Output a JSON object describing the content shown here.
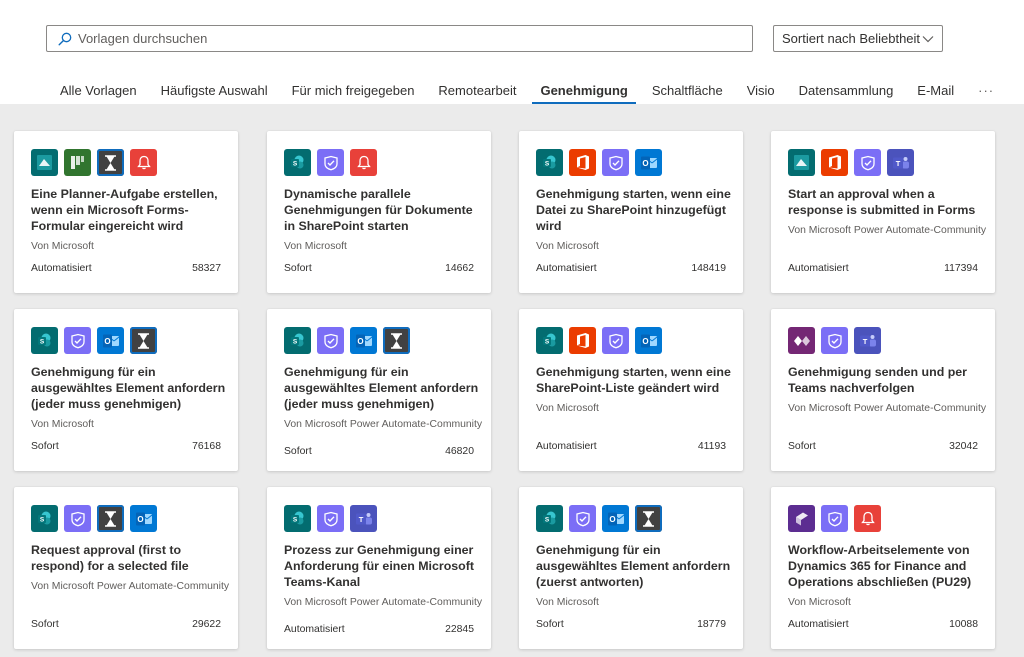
{
  "search": {
    "placeholder": "Vorlagen durchsuchen"
  },
  "sort": {
    "label": "Sortiert nach Beliebtheit"
  },
  "tabs": [
    {
      "label": "Alle Vorlagen",
      "active": false
    },
    {
      "label": "Häufigste Auswahl",
      "active": false
    },
    {
      "label": "Für mich freigegeben",
      "active": false
    },
    {
      "label": "Remotearbeit",
      "active": false
    },
    {
      "label": "Genehmigung",
      "active": true
    },
    {
      "label": "Schaltfläche",
      "active": false
    },
    {
      "label": "Visio",
      "active": false
    },
    {
      "label": "Datensammlung",
      "active": false
    },
    {
      "label": "E-Mail",
      "active": false
    }
  ],
  "more_tabs": "···",
  "colors": {
    "forms": "#036c70",
    "planner": "#31752f",
    "timer": "#414141",
    "notification": "#e8413a",
    "sharepoint": "#036c70",
    "approvals": "#7b6ef6",
    "office": "#eb3c00",
    "outlook": "#0078d4",
    "teams": "#4b53bc",
    "powerapps": "#742774",
    "dynamics": "#5c2d91",
    "accent": "#0f6cbd"
  },
  "cards": [
    {
      "title": "Eine Planner-Aufgabe erstellen, wenn ein Microsoft Forms-Formular eingereicht wird",
      "author": "Von Microsoft",
      "type": "Automatisiert",
      "count": "58327",
      "icons": [
        "forms-icon",
        "planner-icon",
        "timer-icon",
        "notification-icon"
      ]
    },
    {
      "title": "Dynamische parallele Genehmigungen für Dokumente in SharePoint starten",
      "author": "Von Microsoft",
      "type": "Sofort",
      "count": "14662",
      "icons": [
        "sharepoint-icon",
        "approvals-icon",
        "notification-icon"
      ]
    },
    {
      "title": "Genehmigung starten, wenn eine Datei zu SharePoint hinzugefügt wird",
      "author": "Von Microsoft",
      "type": "Automatisiert",
      "count": "148419",
      "icons": [
        "sharepoint-icon",
        "office-icon",
        "approvals-icon",
        "outlook-icon"
      ]
    },
    {
      "title": "Start an approval when a response is submitted in Forms",
      "author": "Von Microsoft Power Automate-Community",
      "type": "Automatisiert",
      "count": "117394",
      "icons": [
        "forms-icon",
        "office-icon",
        "approvals-icon",
        "teams-icon"
      ]
    },
    {
      "title": "Genehmigung für ein ausgewähltes Element anfordern (jeder muss genehmigen)",
      "author": "Von Microsoft",
      "type": "Sofort",
      "count": "76168",
      "icons": [
        "sharepoint-icon",
        "approvals-icon",
        "outlook-icon",
        "timer-icon"
      ]
    },
    {
      "title": "Genehmigung für ein ausgewähltes Element anfordern (jeder muss genehmigen)",
      "author": "Von Microsoft Power Automate-Community",
      "type": "Sofort",
      "count": "46820",
      "icons": [
        "sharepoint-icon",
        "approvals-icon",
        "outlook-icon",
        "timer-icon"
      ]
    },
    {
      "title": "Genehmigung starten, wenn eine SharePoint-Liste geändert wird",
      "author": "Von Microsoft",
      "type": "Automatisiert",
      "count": "41193",
      "icons": [
        "sharepoint-icon",
        "office-icon",
        "approvals-icon",
        "outlook-icon"
      ]
    },
    {
      "title": "Genehmigung senden und per Teams nachverfolgen",
      "author": "Von Microsoft Power Automate-Community",
      "type": "Sofort",
      "count": "32042",
      "icons": [
        "powerapps-icon",
        "approvals-icon",
        "teams-icon"
      ]
    },
    {
      "title": "Request approval (first to respond) for a selected file",
      "author": "Von Microsoft Power Automate-Community",
      "type": "Sofort",
      "count": "29622",
      "icons": [
        "sharepoint-icon",
        "approvals-icon",
        "timer-icon",
        "outlook-icon"
      ]
    },
    {
      "title": "Prozess zur Genehmigung einer Anforderung für einen Microsoft Teams-Kanal",
      "author": "Von Microsoft Power Automate-Community",
      "type": "Automatisiert",
      "count": "22845",
      "icons": [
        "sharepoint-icon",
        "approvals-icon",
        "teams-icon"
      ]
    },
    {
      "title": "Genehmigung für ein ausgewähltes Element anfordern (zuerst antworten)",
      "author": "Von Microsoft",
      "type": "Sofort",
      "count": "18779",
      "icons": [
        "sharepoint-icon",
        "approvals-icon",
        "outlook-icon",
        "timer-icon"
      ]
    },
    {
      "title": "Workflow-Arbeitselemente von Dynamics 365 for Finance and Operations abschließen (PU29)",
      "author": "Von Microsoft",
      "type": "Automatisiert",
      "count": "10088",
      "icons": [
        "dynamics-icon",
        "approvals-icon",
        "notification-icon"
      ]
    }
  ]
}
